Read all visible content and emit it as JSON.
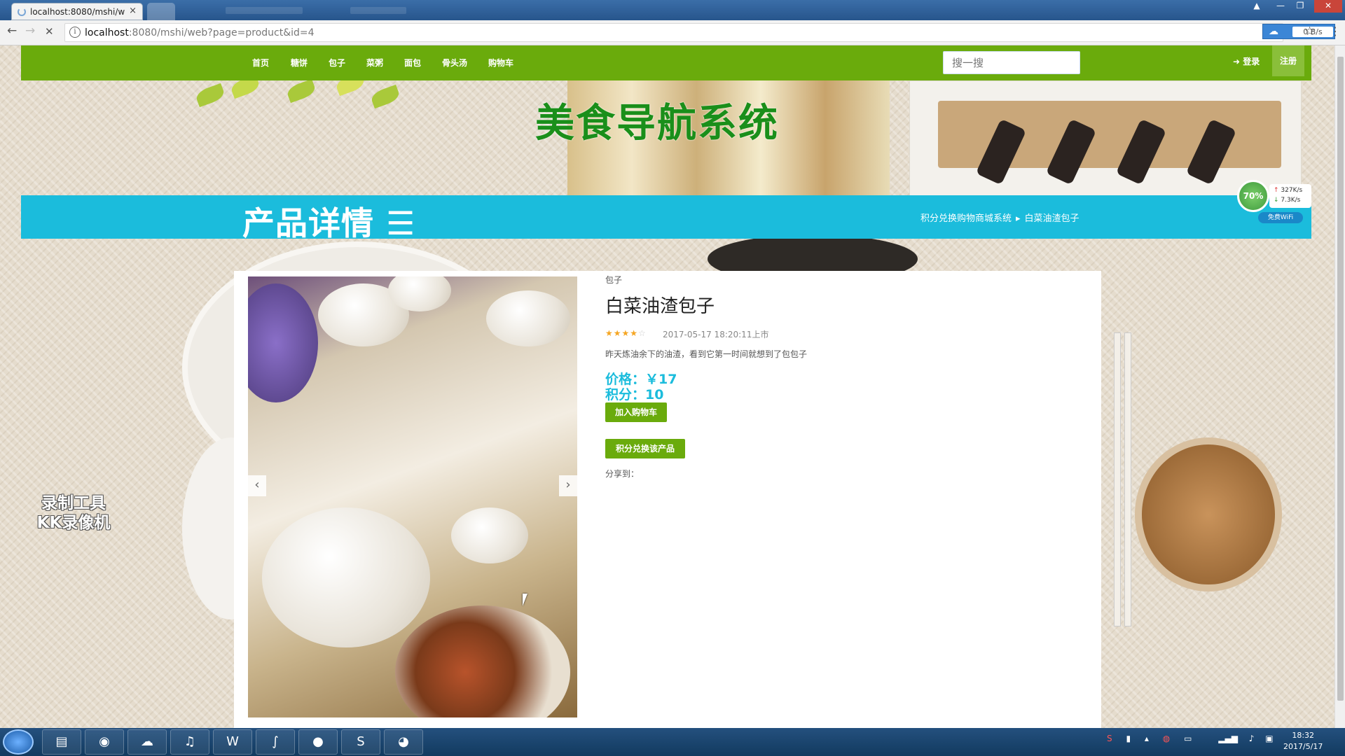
{
  "browser": {
    "tab_title": "localhost:8080/mshi/w",
    "tab_close": "×",
    "url_host": "localhost",
    "url_rest": ":8080/mshi/web?page=product&id=4",
    "speed": "0 B/s",
    "star": "☆",
    "menu": "⋮",
    "back": "←",
    "forward": "→",
    "reload": "✕"
  },
  "nav": {
    "items": [
      "首页",
      "糖饼",
      "包子",
      "菜粥",
      "面包",
      "骨头汤",
      "购物车"
    ],
    "search_placeholder": "搜一搜",
    "login": "登录",
    "register": "注册"
  },
  "banner": {
    "site_title": "美食导航系统"
  },
  "titlebar": {
    "page_title": "产品详情",
    "breadcrumb": [
      "积分兑换购物商城系统",
      "白菜油渣包子"
    ]
  },
  "net_widget": {
    "percent": "70%",
    "up": "327K/s",
    "down": "7.3K/s",
    "wifi": "免费WiFi"
  },
  "product": {
    "category": "包子",
    "name": "白菜油渣包子",
    "rating": 4,
    "rating_max": 5,
    "stars_on": "★★★★",
    "stars_off": "☆",
    "date": "2017-05-17 18:20:11上市",
    "description": "昨天炼油余下的油渣，看到它第一时间就想到了包包子",
    "price_label": "价格：￥17",
    "points_label": "积分：10",
    "add_to_cart": "加入购物车",
    "redeem": "积分兑换该产品",
    "share": "分享到："
  },
  "watermark": {
    "line1": "录制工具",
    "line2": "KK录像机"
  },
  "taskbar": {
    "time": "18:32",
    "date": "2017/5/17"
  }
}
